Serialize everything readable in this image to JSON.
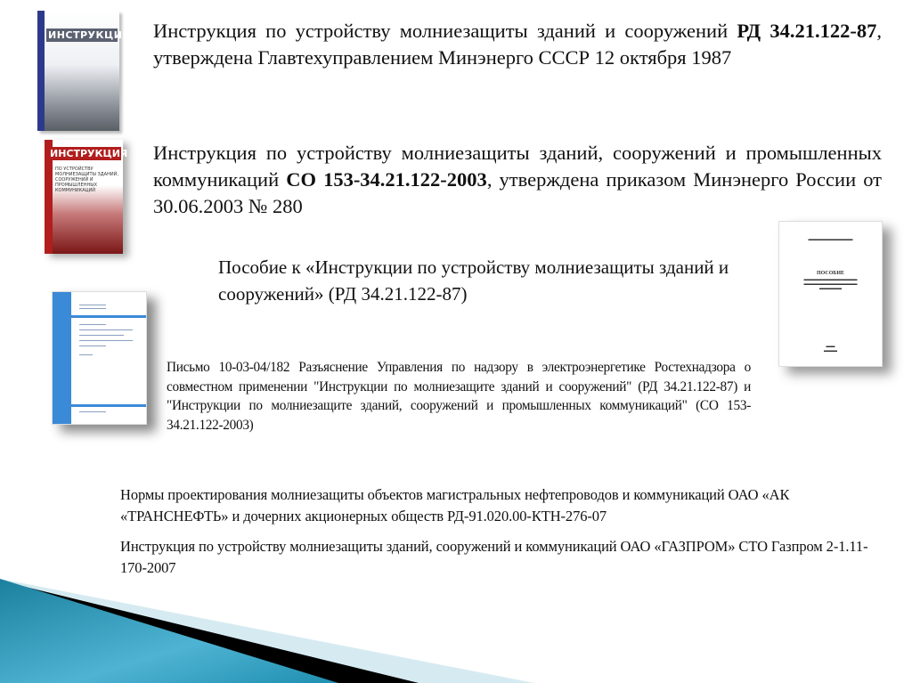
{
  "items": [
    {
      "pre": "Инструкция по устройству молниезащиты зданий и сооружений ",
      "code": "РД 34.21.122-87",
      "post": ", утверждена Главтехуправлением Минэнерго СССР 12 октября 1987",
      "cover_lettering": "ИНСТРУКЦИЯ"
    },
    {
      "pre": "Инструкция по устройству молниезащиты зданий, сооружений и промышленных коммуникаций ",
      "code": "СО 153-34.21.122-2003",
      "post": ", утверждена приказом Минэнерго России от 30.06.2003 № 280",
      "cover_lettering": "ИНСТРУКЦИЯ",
      "cover_subtitle": "по устройству молниезащиты зданий, сооружений и промышленных коммуникаций"
    },
    {
      "text": "Пособие к «Инструкции по устройству молниезащиты зданий и сооружений» (РД 34.21.122-87)",
      "cover_lettering": "ПОСОБИЕ"
    },
    {
      "text": "Письмо 10-03-04/182 Разъяснение Управления по надзору в электроэнергетике Ростехнадзора о совместном применении \"Инструкции по молниезащите зданий и сооружений\" (РД 34.21.122-87) и \"Инструкции по молниезащите зданий, сооружений и промышленных коммуникаций\" (СО 153-34.21.122-2003)"
    },
    {
      "text": "Нормы проектирования молниезащиты объектов магистральных нефтепроводов и коммуникаций ОАО «АК «ТРАНСНЕФТЬ» и дочерних акционерных обществ РД-91.020.00-КТН-276-07"
    },
    {
      "text": "Инструкция по устройству молниезащиты зданий, сооружений и коммуникаций ОАО «ГАЗПРОМ» СТО Газпром 2-1.11-170-2007"
    }
  ],
  "colors": {
    "accent_blue": "#1f8fb0",
    "book1_spine": "#2d3a8c",
    "book2_red": "#b21d1d",
    "doc_blue": "#3b8ad8"
  }
}
